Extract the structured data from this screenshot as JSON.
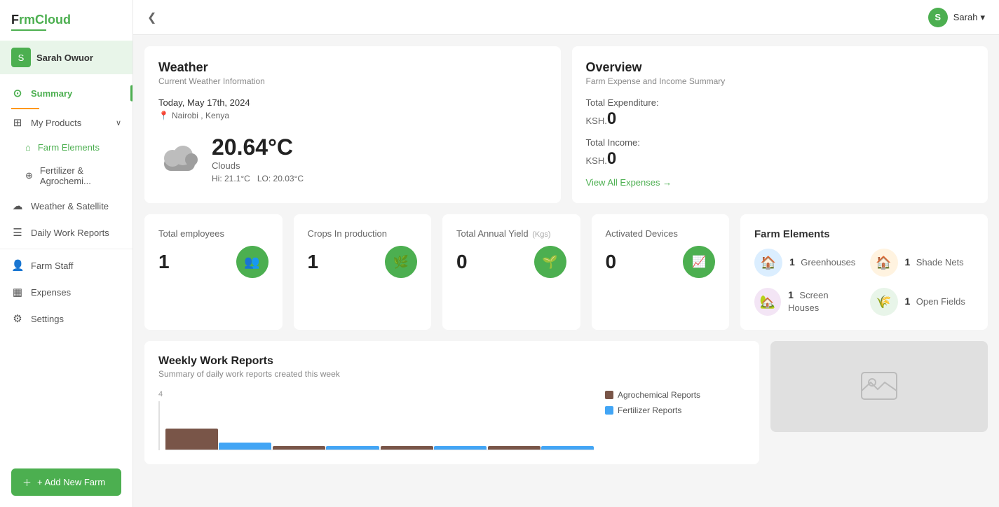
{
  "app": {
    "name": "F",
    "name_colored": "rmCloud"
  },
  "user": {
    "name": "Sarah Owuor",
    "short": "S",
    "display": "Sarah"
  },
  "sidebar": {
    "items": [
      {
        "id": "summary",
        "label": "Summary",
        "icon": "⊙",
        "active": true
      },
      {
        "id": "my-products",
        "label": "My Products",
        "icon": "⊞",
        "has_chevron": true
      },
      {
        "id": "farm-elements",
        "label": "Farm Elements",
        "icon": "⌂",
        "sub": true
      },
      {
        "id": "fertilizer",
        "label": "Fertilizer & Agrochemi...",
        "icon": "⊕",
        "sub": true
      },
      {
        "id": "weather",
        "label": "Weather & Satellite",
        "icon": "☁",
        "active": false
      },
      {
        "id": "daily-reports",
        "label": "Daily Work Reports",
        "icon": "☰",
        "active": false
      },
      {
        "id": "farm-staff",
        "label": "Farm Staff",
        "icon": "👤",
        "active": false
      },
      {
        "id": "expenses",
        "label": "Expenses",
        "icon": "▦",
        "active": false
      },
      {
        "id": "settings",
        "label": "Settings",
        "icon": "⚙",
        "active": false
      }
    ],
    "add_farm_label": "+ Add New Farm"
  },
  "topbar": {
    "collapse_icon": "❮"
  },
  "weather": {
    "title": "Weather",
    "subtitle": "Current Weather Information",
    "date": "Today, May 17th, 2024",
    "location": "Nairobi , Kenya",
    "temp": "20.64°C",
    "description": "Clouds",
    "hi": "Hi: 21.1°C",
    "lo": "LO: 20.03°C"
  },
  "overview": {
    "title": "Overview",
    "subtitle": "Farm Expense and Income Summary",
    "expenditure_label": "Total Expenditure:",
    "expenditure_prefix": "KSH.",
    "expenditure_value": "0",
    "income_label": "Total Income:",
    "income_prefix": "KSH.",
    "income_value": "0",
    "view_expenses": "View All Expenses →"
  },
  "stats": [
    {
      "id": "employees",
      "label": "Total employees",
      "value": "1",
      "icon": "👥"
    },
    {
      "id": "crops",
      "label": "Crops In production",
      "value": "1",
      "icon": "🌿"
    },
    {
      "id": "yield",
      "label": "Total Annual Yield",
      "label_suffix": "(Kgs)",
      "value": "0",
      "icon": "🌱"
    },
    {
      "id": "devices",
      "label": "Activated Devices",
      "value": "0",
      "icon": "📈"
    }
  ],
  "farm_elements": {
    "title": "Farm Elements",
    "items": [
      {
        "id": "greenhouses",
        "label": "Greenhouses",
        "count": "1",
        "color": "#a5c8f0",
        "bg": "#dbeeff",
        "icon": "🏠"
      },
      {
        "id": "shade-nets",
        "label": "Shade Nets",
        "count": "1",
        "color": "#f5a623",
        "bg": "#fff3e0",
        "icon": "🏠"
      },
      {
        "id": "screen-houses",
        "label": "Screen Houses",
        "count": "1",
        "color": "#ba68c8",
        "bg": "#f3e5f5",
        "icon": "🏡"
      },
      {
        "id": "open-fields",
        "label": "Open Fields",
        "count": "1",
        "color": "#4caf50",
        "bg": "#e8f5e9",
        "icon": "🌾"
      }
    ]
  },
  "weekly_reports": {
    "title": "Weekly Work Reports",
    "subtitle": "Summary of daily work reports created this week",
    "y_axis_label": "4",
    "legend": [
      {
        "label": "Agrochemical Reports",
        "color": "#795548"
      },
      {
        "label": "Fertilizer Reports",
        "color": "#42a5f5"
      }
    ]
  }
}
